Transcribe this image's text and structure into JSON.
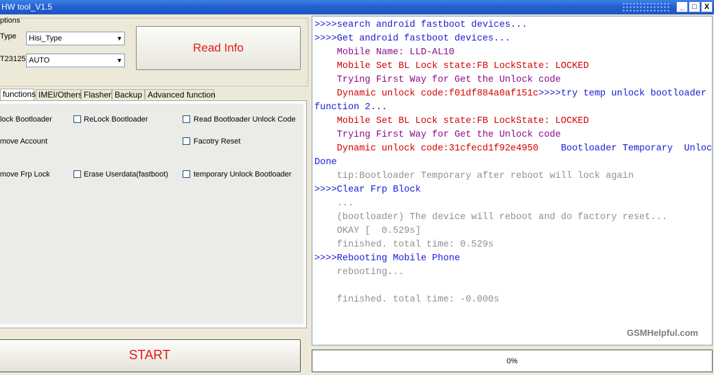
{
  "window": {
    "title": "HW tool_V1.5",
    "minimize": "_",
    "maximize": "□",
    "close": "X"
  },
  "options": {
    "group_label": "ptions",
    "type_label": "Type",
    "type_value": "Hisi_Type",
    "port_label": "T23125",
    "port_value": "AUTO",
    "read_info": "Read Info"
  },
  "tabs": [
    "functions",
    "IMEI/Others",
    "Flasher",
    "Backup",
    "Advanced function"
  ],
  "functions": {
    "unlock_bootloader": "lock Bootloader",
    "relock_bootloader": "ReLock Bootloader",
    "read_unlock_code": "Read Bootloader Unlock Code",
    "remove_account": "move Account",
    "factory_reset": "Facotry Reset",
    "remove_frp": "move Frp Lock",
    "erase_userdata": "Erase Userdata(fastboot)",
    "temp_unlock": "temporary Unlock Bootloader"
  },
  "start": "START",
  "log": {
    "lines": [
      {
        "text": ">>>>search android fastboot devices...",
        "color": "#1a1ad6"
      },
      {
        "text": ">>>>Get android fastboot devices...",
        "color": "#1a1ad6"
      },
      {
        "text": "    Mobile Name: LLD-AL10",
        "color": "#8b0a8b"
      },
      {
        "text": "    Mobile Set BL Lock state:FB LockState: LOCKED",
        "color": "#d40000"
      },
      {
        "text": "    Trying First Way for Get the Unlock code",
        "color": "#8b0a8b"
      },
      {
        "text": "    Dynamic unlock code:f01df884a0af151c",
        "color": "#d40000",
        "tail": ">>>>try temp unlock bootloader",
        "tail_color": "#1a1ad6"
      },
      {
        "text": "function 2...",
        "color": "#1a1ad6"
      },
      {
        "text": "    Mobile Set BL Lock state:FB LockState: LOCKED",
        "color": "#d40000"
      },
      {
        "text": "    Trying First Way for Get the Unlock code",
        "color": "#8b0a8b"
      },
      {
        "text": "    Dynamic unlock code:31cfecd1f92e4950",
        "color": "#d40000",
        "tail": "    Bootloader Temporary  Unlock",
        "tail_color": "#1a1ad6"
      },
      {
        "text": "Done",
        "color": "#1a1ad6"
      },
      {
        "text": "    tip:Bootloader Temporary after reboot will lock again",
        "color": "#909090"
      },
      {
        "text": ">>>>Clear Frp Block",
        "color": "#1a1ad6"
      },
      {
        "text": "    ...",
        "color": "#909090"
      },
      {
        "text": "    (bootloader) The device will reboot and do factory reset...",
        "color": "#909090"
      },
      {
        "text": "    OKAY [  0.529s]",
        "color": "#909090"
      },
      {
        "text": "    finished. total time: 0.529s",
        "color": "#909090"
      },
      {
        "text": ">>>>Rebooting Mobile Phone",
        "color": "#1a1ad6"
      },
      {
        "text": "    rebooting...",
        "color": "#909090"
      },
      {
        "text": "",
        "color": "#909090"
      },
      {
        "text": "    finished. total time: -0.000s",
        "color": "#909090"
      }
    ],
    "watermark": "GSMHelpful.com"
  },
  "progress": {
    "label": "0%",
    "value": 0
  }
}
